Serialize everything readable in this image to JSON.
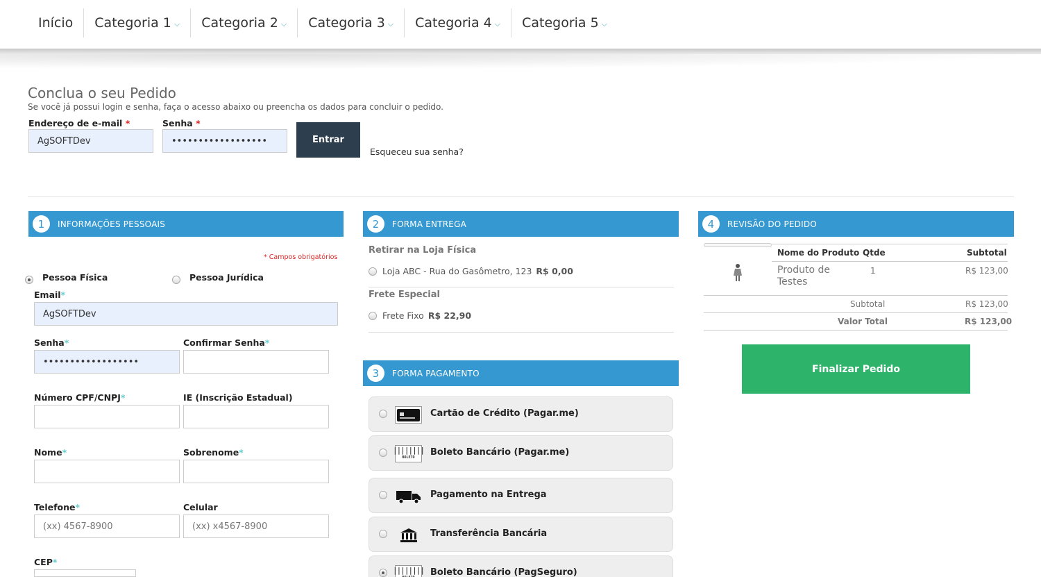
{
  "nav": {
    "items": [
      {
        "label": "Início",
        "dropdown": false
      },
      {
        "label": "Categoria 1",
        "dropdown": true
      },
      {
        "label": "Categoria 2",
        "dropdown": true
      },
      {
        "label": "Categoria 3",
        "dropdown": true
      },
      {
        "label": "Categoria 4",
        "dropdown": true
      },
      {
        "label": "Categoria 5",
        "dropdown": true
      }
    ],
    "chevron": "⌵"
  },
  "login": {
    "title": "Conclua o seu Pedido",
    "subtitle": "Se você já possui login e senha, faça o acesso abaixo ou preencha os dados para concluir o pedido.",
    "email_label": "Endereço de e-mail",
    "email_value": "AgSOFTDev",
    "password_label": "Senha",
    "password_value": "••••••••••••••••••",
    "submit_label": "Entrar",
    "forgot_label": "Esqueceu sua senha?",
    "required_mark": "*"
  },
  "personal": {
    "number": "1",
    "title": "INFORMAÇÕES PESSOAIS",
    "required_note": "* Campos obrigatórios",
    "person_types": [
      {
        "label": "Pessoa Física",
        "selected": true
      },
      {
        "label": "Pessoa Jurídica",
        "selected": false
      }
    ],
    "fields": {
      "email": {
        "label": "Email",
        "value": "AgSOFTDev",
        "required": true
      },
      "senha": {
        "label": "Senha",
        "value": "••••••••••••••••••",
        "required": true
      },
      "confirmar": {
        "label": "Confirmar Senha",
        "value": "",
        "required": true
      },
      "cpf": {
        "label": "Número CPF/CNPJ",
        "value": "",
        "required": true
      },
      "ie": {
        "label": "IE (Inscrição Estadual)",
        "value": "",
        "required": false
      },
      "nome": {
        "label": "Nome",
        "value": "",
        "required": true
      },
      "sobrenome": {
        "label": "Sobrenome",
        "value": "",
        "required": true
      },
      "telefone": {
        "label": "Telefone",
        "placeholder": "(xx) 4567-8900",
        "required": true
      },
      "celular": {
        "label": "Celular",
        "placeholder": "(xx) x4567-8900",
        "required": false
      },
      "cep": {
        "label": "CEP",
        "value": "",
        "required": true
      }
    },
    "required_mark": "*"
  },
  "delivery": {
    "number": "2",
    "title": "FORMA ENTREGA",
    "groups": [
      {
        "title": "Retirar na Loja Física",
        "option": "Loja ABC - Rua do Gasômetro, 123",
        "price": "R$ 0,00",
        "selected": false
      },
      {
        "title": "Frete Especial",
        "option": "Frete Fixo",
        "price": "R$ 22,90",
        "selected": false
      }
    ]
  },
  "payment": {
    "number": "3",
    "title": "FORMA PAGAMENTO",
    "options": [
      {
        "label": "Cartão de Crédito (Pagar.me)",
        "icon": "credit-card-icon",
        "selected": false
      },
      {
        "label": "Boleto Bancário (Pagar.me)",
        "icon": "boleto-icon",
        "selected": false
      },
      {
        "label": "Pagamento na Entrega",
        "icon": "truck-icon",
        "selected": false
      },
      {
        "label": "Transferência Bancária",
        "icon": "bank-icon",
        "selected": false
      },
      {
        "label": "Boleto Bancário (PagSeguro)",
        "icon": "boleto-icon",
        "selected": true
      }
    ],
    "boleto_text": "BOLETO"
  },
  "review": {
    "number": "4",
    "title": "REVISÃO DO PEDIDO",
    "col_product": "Nome do Produto",
    "col_qty": "Qtde",
    "col_subtotal": "Subtotal",
    "item": {
      "name": "Produto de Testes",
      "qty": "1",
      "subtotal": "R$ 123,00"
    },
    "subtotal_label": "Subtotal",
    "subtotal_value": "R$ 123,00",
    "total_label": "Valor Total",
    "total_value": "R$ 123,00",
    "finalize_label": "Finalizar Pedido"
  }
}
